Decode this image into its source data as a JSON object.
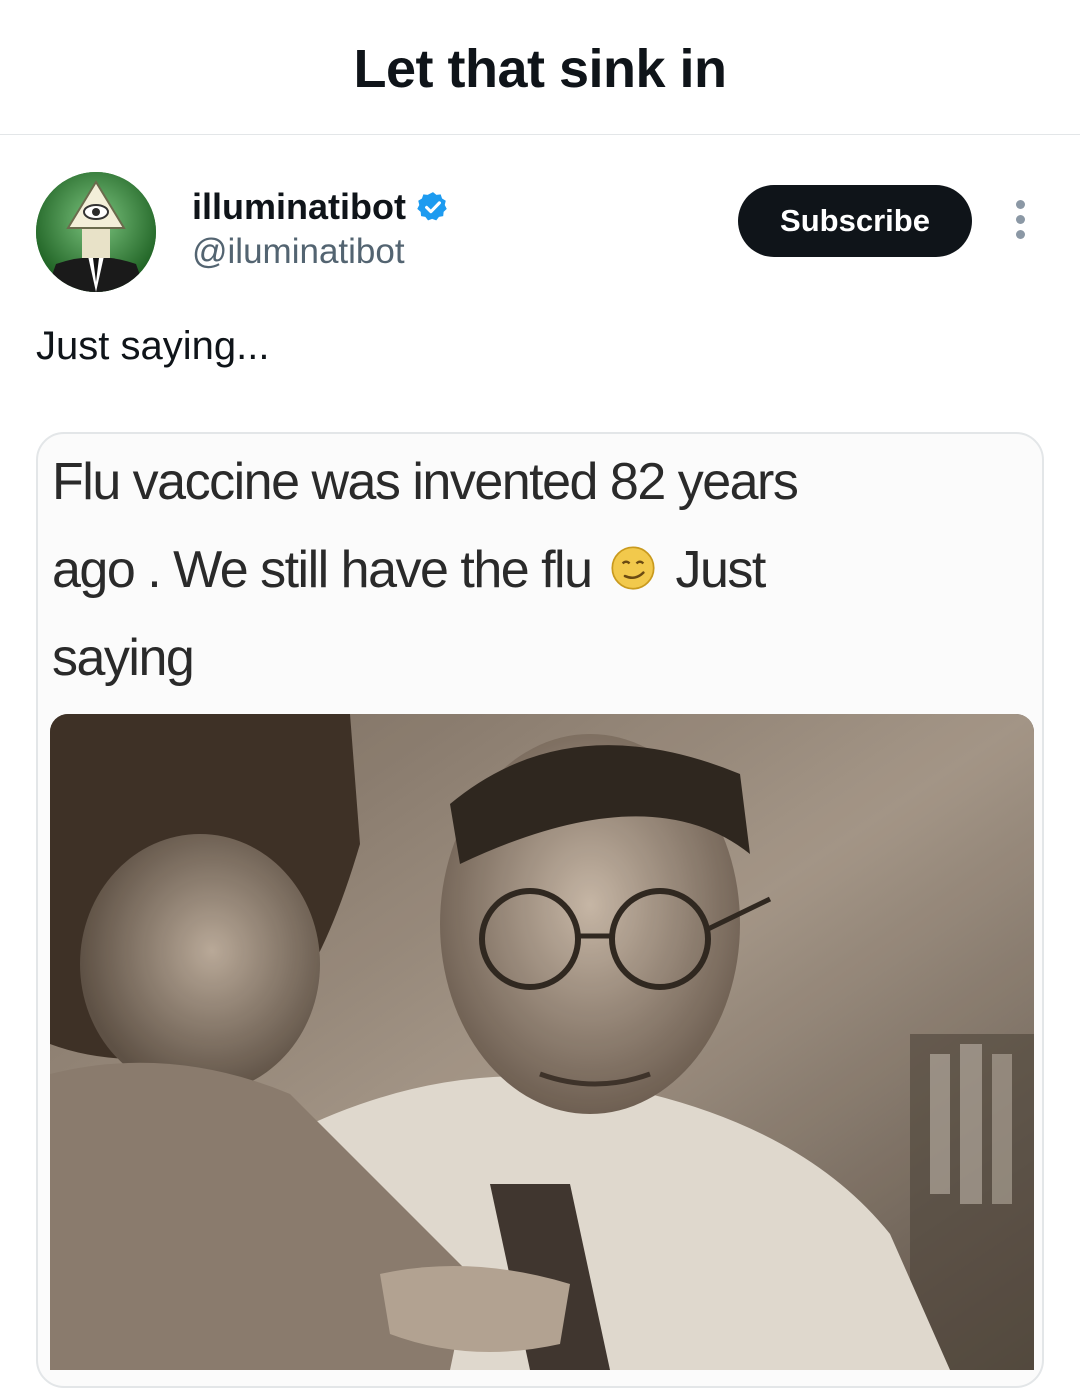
{
  "header": {
    "title": "Let that sink in"
  },
  "post": {
    "author_name": "illuminatibot",
    "author_handle": "@iluminatibot",
    "subscribe_label": "Subscribe",
    "text": "Just saying...",
    "verified_color": "#1d9bf0"
  },
  "media": {
    "meme_line1": "Flu vaccine was invented 82 years",
    "meme_line2_a": "ago . We still have the flu",
    "meme_line2_b": "Just",
    "meme_line3": "saying",
    "photo_description_icon": "sepia-photo"
  }
}
